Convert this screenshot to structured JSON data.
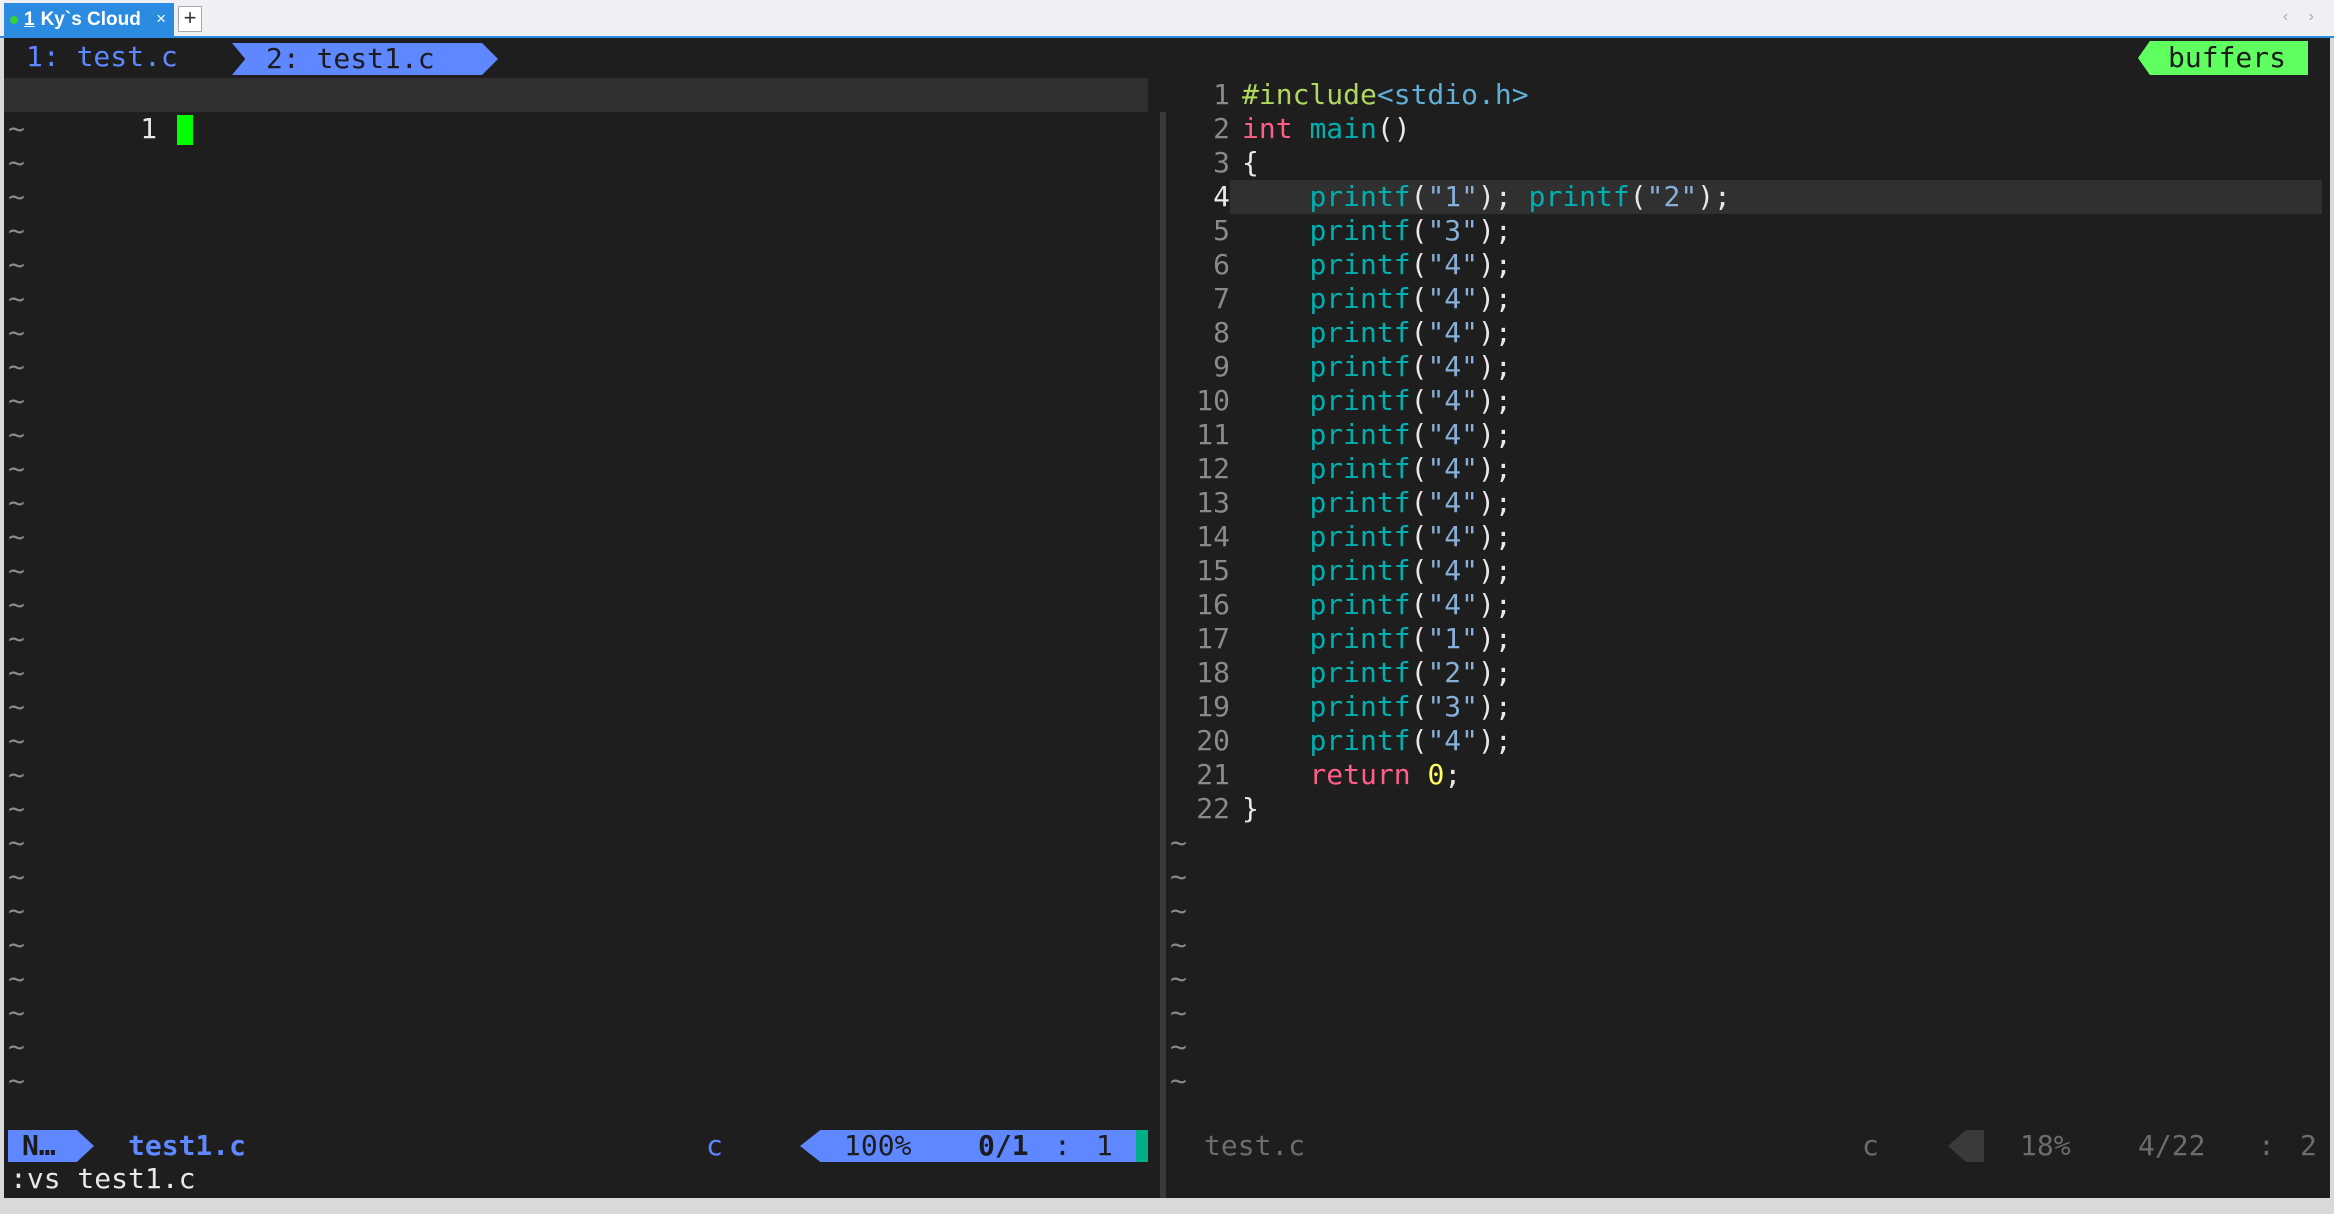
{
  "window": {
    "tab_number": "1",
    "tab_title": "Ky`s Cloud",
    "tab_close": "×",
    "new_tab": "+",
    "scroll_arrows": "‹ ›"
  },
  "bufferline": {
    "buf1": "1: test.c",
    "buf2": "2: test1.c",
    "buffers_label": "buffers"
  },
  "left_pane": {
    "line_number": "1",
    "tilde": "~"
  },
  "right_pane": {
    "lines": [
      {
        "n": "1",
        "segments": [
          {
            "t": "#include",
            "c": "kw-pp"
          },
          {
            "t": "<stdio.h>",
            "c": "kw-inc"
          }
        ]
      },
      {
        "n": "2",
        "segments": [
          {
            "t": "int",
            "c": "kw-type"
          },
          {
            "t": " ",
            "c": ""
          },
          {
            "t": "main",
            "c": "kw-fn"
          },
          {
            "t": "()",
            "c": ""
          }
        ]
      },
      {
        "n": "3",
        "segments": [
          {
            "t": "{",
            "c": ""
          }
        ]
      },
      {
        "n": "4",
        "segments": [
          {
            "t": "    ",
            "c": ""
          },
          {
            "t": "printf",
            "c": "kw-fn"
          },
          {
            "t": "(",
            "c": ""
          },
          {
            "t": "\"1\"",
            "c": "kw-str"
          },
          {
            "t": "); ",
            "c": ""
          },
          {
            "t": "printf",
            "c": "kw-fn"
          },
          {
            "t": "(",
            "c": ""
          },
          {
            "t": "\"2\"",
            "c": "kw-str"
          },
          {
            "t": ");",
            "c": ""
          }
        ]
      },
      {
        "n": "5",
        "segments": [
          {
            "t": "    ",
            "c": ""
          },
          {
            "t": "printf",
            "c": "kw-fn"
          },
          {
            "t": "(",
            "c": ""
          },
          {
            "t": "\"3\"",
            "c": "kw-str"
          },
          {
            "t": ");",
            "c": ""
          }
        ]
      },
      {
        "n": "6",
        "segments": [
          {
            "t": "    ",
            "c": ""
          },
          {
            "t": "printf",
            "c": "kw-fn"
          },
          {
            "t": "(",
            "c": ""
          },
          {
            "t": "\"4\"",
            "c": "kw-str"
          },
          {
            "t": ");",
            "c": ""
          }
        ]
      },
      {
        "n": "7",
        "segments": [
          {
            "t": "    ",
            "c": ""
          },
          {
            "t": "printf",
            "c": "kw-fn"
          },
          {
            "t": "(",
            "c": ""
          },
          {
            "t": "\"4\"",
            "c": "kw-str"
          },
          {
            "t": ");",
            "c": ""
          }
        ]
      },
      {
        "n": "8",
        "segments": [
          {
            "t": "    ",
            "c": ""
          },
          {
            "t": "printf",
            "c": "kw-fn"
          },
          {
            "t": "(",
            "c": ""
          },
          {
            "t": "\"4\"",
            "c": "kw-str"
          },
          {
            "t": ");",
            "c": ""
          }
        ]
      },
      {
        "n": "9",
        "segments": [
          {
            "t": "    ",
            "c": ""
          },
          {
            "t": "printf",
            "c": "kw-fn"
          },
          {
            "t": "(",
            "c": ""
          },
          {
            "t": "\"4\"",
            "c": "kw-str"
          },
          {
            "t": ");",
            "c": ""
          }
        ]
      },
      {
        "n": "10",
        "segments": [
          {
            "t": "    ",
            "c": ""
          },
          {
            "t": "printf",
            "c": "kw-fn"
          },
          {
            "t": "(",
            "c": ""
          },
          {
            "t": "\"4\"",
            "c": "kw-str"
          },
          {
            "t": ");",
            "c": ""
          }
        ]
      },
      {
        "n": "11",
        "segments": [
          {
            "t": "    ",
            "c": ""
          },
          {
            "t": "printf",
            "c": "kw-fn"
          },
          {
            "t": "(",
            "c": ""
          },
          {
            "t": "\"4\"",
            "c": "kw-str"
          },
          {
            "t": ");",
            "c": ""
          }
        ]
      },
      {
        "n": "12",
        "segments": [
          {
            "t": "    ",
            "c": ""
          },
          {
            "t": "printf",
            "c": "kw-fn"
          },
          {
            "t": "(",
            "c": ""
          },
          {
            "t": "\"4\"",
            "c": "kw-str"
          },
          {
            "t": ");",
            "c": ""
          }
        ]
      },
      {
        "n": "13",
        "segments": [
          {
            "t": "    ",
            "c": ""
          },
          {
            "t": "printf",
            "c": "kw-fn"
          },
          {
            "t": "(",
            "c": ""
          },
          {
            "t": "\"4\"",
            "c": "kw-str"
          },
          {
            "t": ");",
            "c": ""
          }
        ]
      },
      {
        "n": "14",
        "segments": [
          {
            "t": "    ",
            "c": ""
          },
          {
            "t": "printf",
            "c": "kw-fn"
          },
          {
            "t": "(",
            "c": ""
          },
          {
            "t": "\"4\"",
            "c": "kw-str"
          },
          {
            "t": ");",
            "c": ""
          }
        ]
      },
      {
        "n": "15",
        "segments": [
          {
            "t": "    ",
            "c": ""
          },
          {
            "t": "printf",
            "c": "kw-fn"
          },
          {
            "t": "(",
            "c": ""
          },
          {
            "t": "\"4\"",
            "c": "kw-str"
          },
          {
            "t": ");",
            "c": ""
          }
        ]
      },
      {
        "n": "16",
        "segments": [
          {
            "t": "    ",
            "c": ""
          },
          {
            "t": "printf",
            "c": "kw-fn"
          },
          {
            "t": "(",
            "c": ""
          },
          {
            "t": "\"4\"",
            "c": "kw-str"
          },
          {
            "t": ");",
            "c": ""
          }
        ]
      },
      {
        "n": "17",
        "segments": [
          {
            "t": "    ",
            "c": ""
          },
          {
            "t": "printf",
            "c": "kw-fn"
          },
          {
            "t": "(",
            "c": ""
          },
          {
            "t": "\"1\"",
            "c": "kw-str"
          },
          {
            "t": ");",
            "c": ""
          }
        ]
      },
      {
        "n": "18",
        "segments": [
          {
            "t": "    ",
            "c": ""
          },
          {
            "t": "printf",
            "c": "kw-fn"
          },
          {
            "t": "(",
            "c": ""
          },
          {
            "t": "\"2\"",
            "c": "kw-str"
          },
          {
            "t": ");",
            "c": ""
          }
        ]
      },
      {
        "n": "19",
        "segments": [
          {
            "t": "    ",
            "c": ""
          },
          {
            "t": "printf",
            "c": "kw-fn"
          },
          {
            "t": "(",
            "c": ""
          },
          {
            "t": "\"3\"",
            "c": "kw-str"
          },
          {
            "t": ");",
            "c": ""
          }
        ]
      },
      {
        "n": "20",
        "segments": [
          {
            "t": "    ",
            "c": ""
          },
          {
            "t": "printf",
            "c": "kw-fn"
          },
          {
            "t": "(",
            "c": ""
          },
          {
            "t": "\"4\"",
            "c": "kw-str"
          },
          {
            "t": ");",
            "c": ""
          }
        ]
      },
      {
        "n": "21",
        "segments": [
          {
            "t": "    ",
            "c": ""
          },
          {
            "t": "return",
            "c": "kw-ret"
          },
          {
            "t": " ",
            "c": ""
          },
          {
            "t": "0",
            "c": "kw-num"
          },
          {
            "t": ";",
            "c": ""
          }
        ]
      },
      {
        "n": "22",
        "segments": [
          {
            "t": "}",
            "c": ""
          }
        ]
      }
    ],
    "cursor_line": "4",
    "tilde": "~"
  },
  "statusline_left": {
    "mode": "N…",
    "filename": "test1.c",
    "filetype": "c",
    "percent": "100%",
    "count": "0/1",
    "colon": ":",
    "column": "1"
  },
  "statusline_right": {
    "filename": "test.c",
    "filetype": "c",
    "percent": "18%",
    "count": "4/22",
    "colon": ":",
    "column": "2"
  },
  "command_line": ":vs test1.c",
  "colors": {
    "accent_blue": "#5f87ff",
    "accent_green": "#5fff5f",
    "cursor": "#00ff00",
    "background": "#1e1e1e"
  }
}
